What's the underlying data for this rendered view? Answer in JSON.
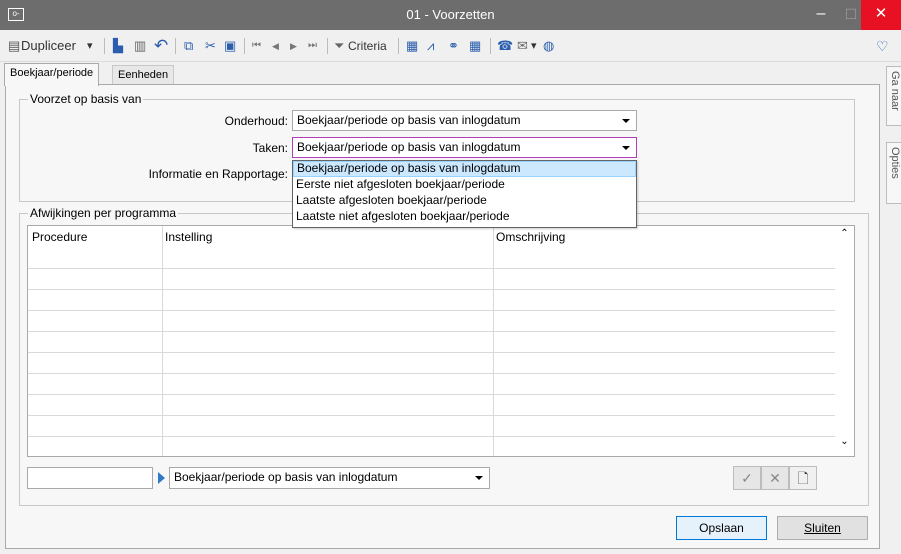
{
  "window": {
    "title": "01 - Voorzetten",
    "app_icon": "o-",
    "min_glyph": "–",
    "max_glyph": "☐",
    "close_glyph": "✕"
  },
  "toolbar": {
    "duplicate_label": "Dupliceer",
    "criteria_label": "Criteria",
    "glyphs": {
      "doc": "▤",
      "caret": "▾",
      "save": "▙",
      "delete": "▥",
      "undo": "↶",
      "copy": "⧉",
      "cut": "✂",
      "paste": "▣",
      "first": "⏮",
      "prev": "◀",
      "next": "▶",
      "last": "⏭",
      "filter": "⏷",
      "excel": "▦",
      "chart": "⩘",
      "binoculars": "⚭",
      "table": "▦",
      "phone": "☎",
      "mail": "✉",
      "globe": "◍",
      "heart": "♡"
    }
  },
  "tabs": [
    {
      "label": "Boekjaar/periode",
      "active": true
    },
    {
      "label": "Eenheden",
      "active": false
    }
  ],
  "side_tabs": [
    "Ga naar",
    "Opties"
  ],
  "voorzet": {
    "legend": "Voorzet op basis van",
    "onderhoud_label": "Onderhoud:",
    "onderhoud_value": "Boekjaar/periode op basis van inlogdatum",
    "taken_label": "Taken:",
    "taken_value": "Boekjaar/periode op basis van inlogdatum",
    "info_label": "Informatie en Rapportage:"
  },
  "dropdown_options": [
    "Boekjaar/periode op basis van inlogdatum",
    "Eerste niet afgesloten boekjaar/periode",
    "Laatste afgesloten boekjaar/periode",
    "Laatste niet afgesloten boekjaar/periode"
  ],
  "afwijkingen": {
    "legend": "Afwijkingen per programma",
    "columns": [
      "Procedure",
      "Instelling",
      "Omschrijving"
    ],
    "scroll_up": "⌃",
    "scroll_down": "⌄"
  },
  "bottom": {
    "instelling_value": "Boekjaar/periode op basis van inlogdatum",
    "check_glyph": "✓",
    "cross_glyph": "✕",
    "new_glyph": "🗋"
  },
  "buttons": {
    "save": "Opslaan",
    "close": "Sluiten"
  }
}
